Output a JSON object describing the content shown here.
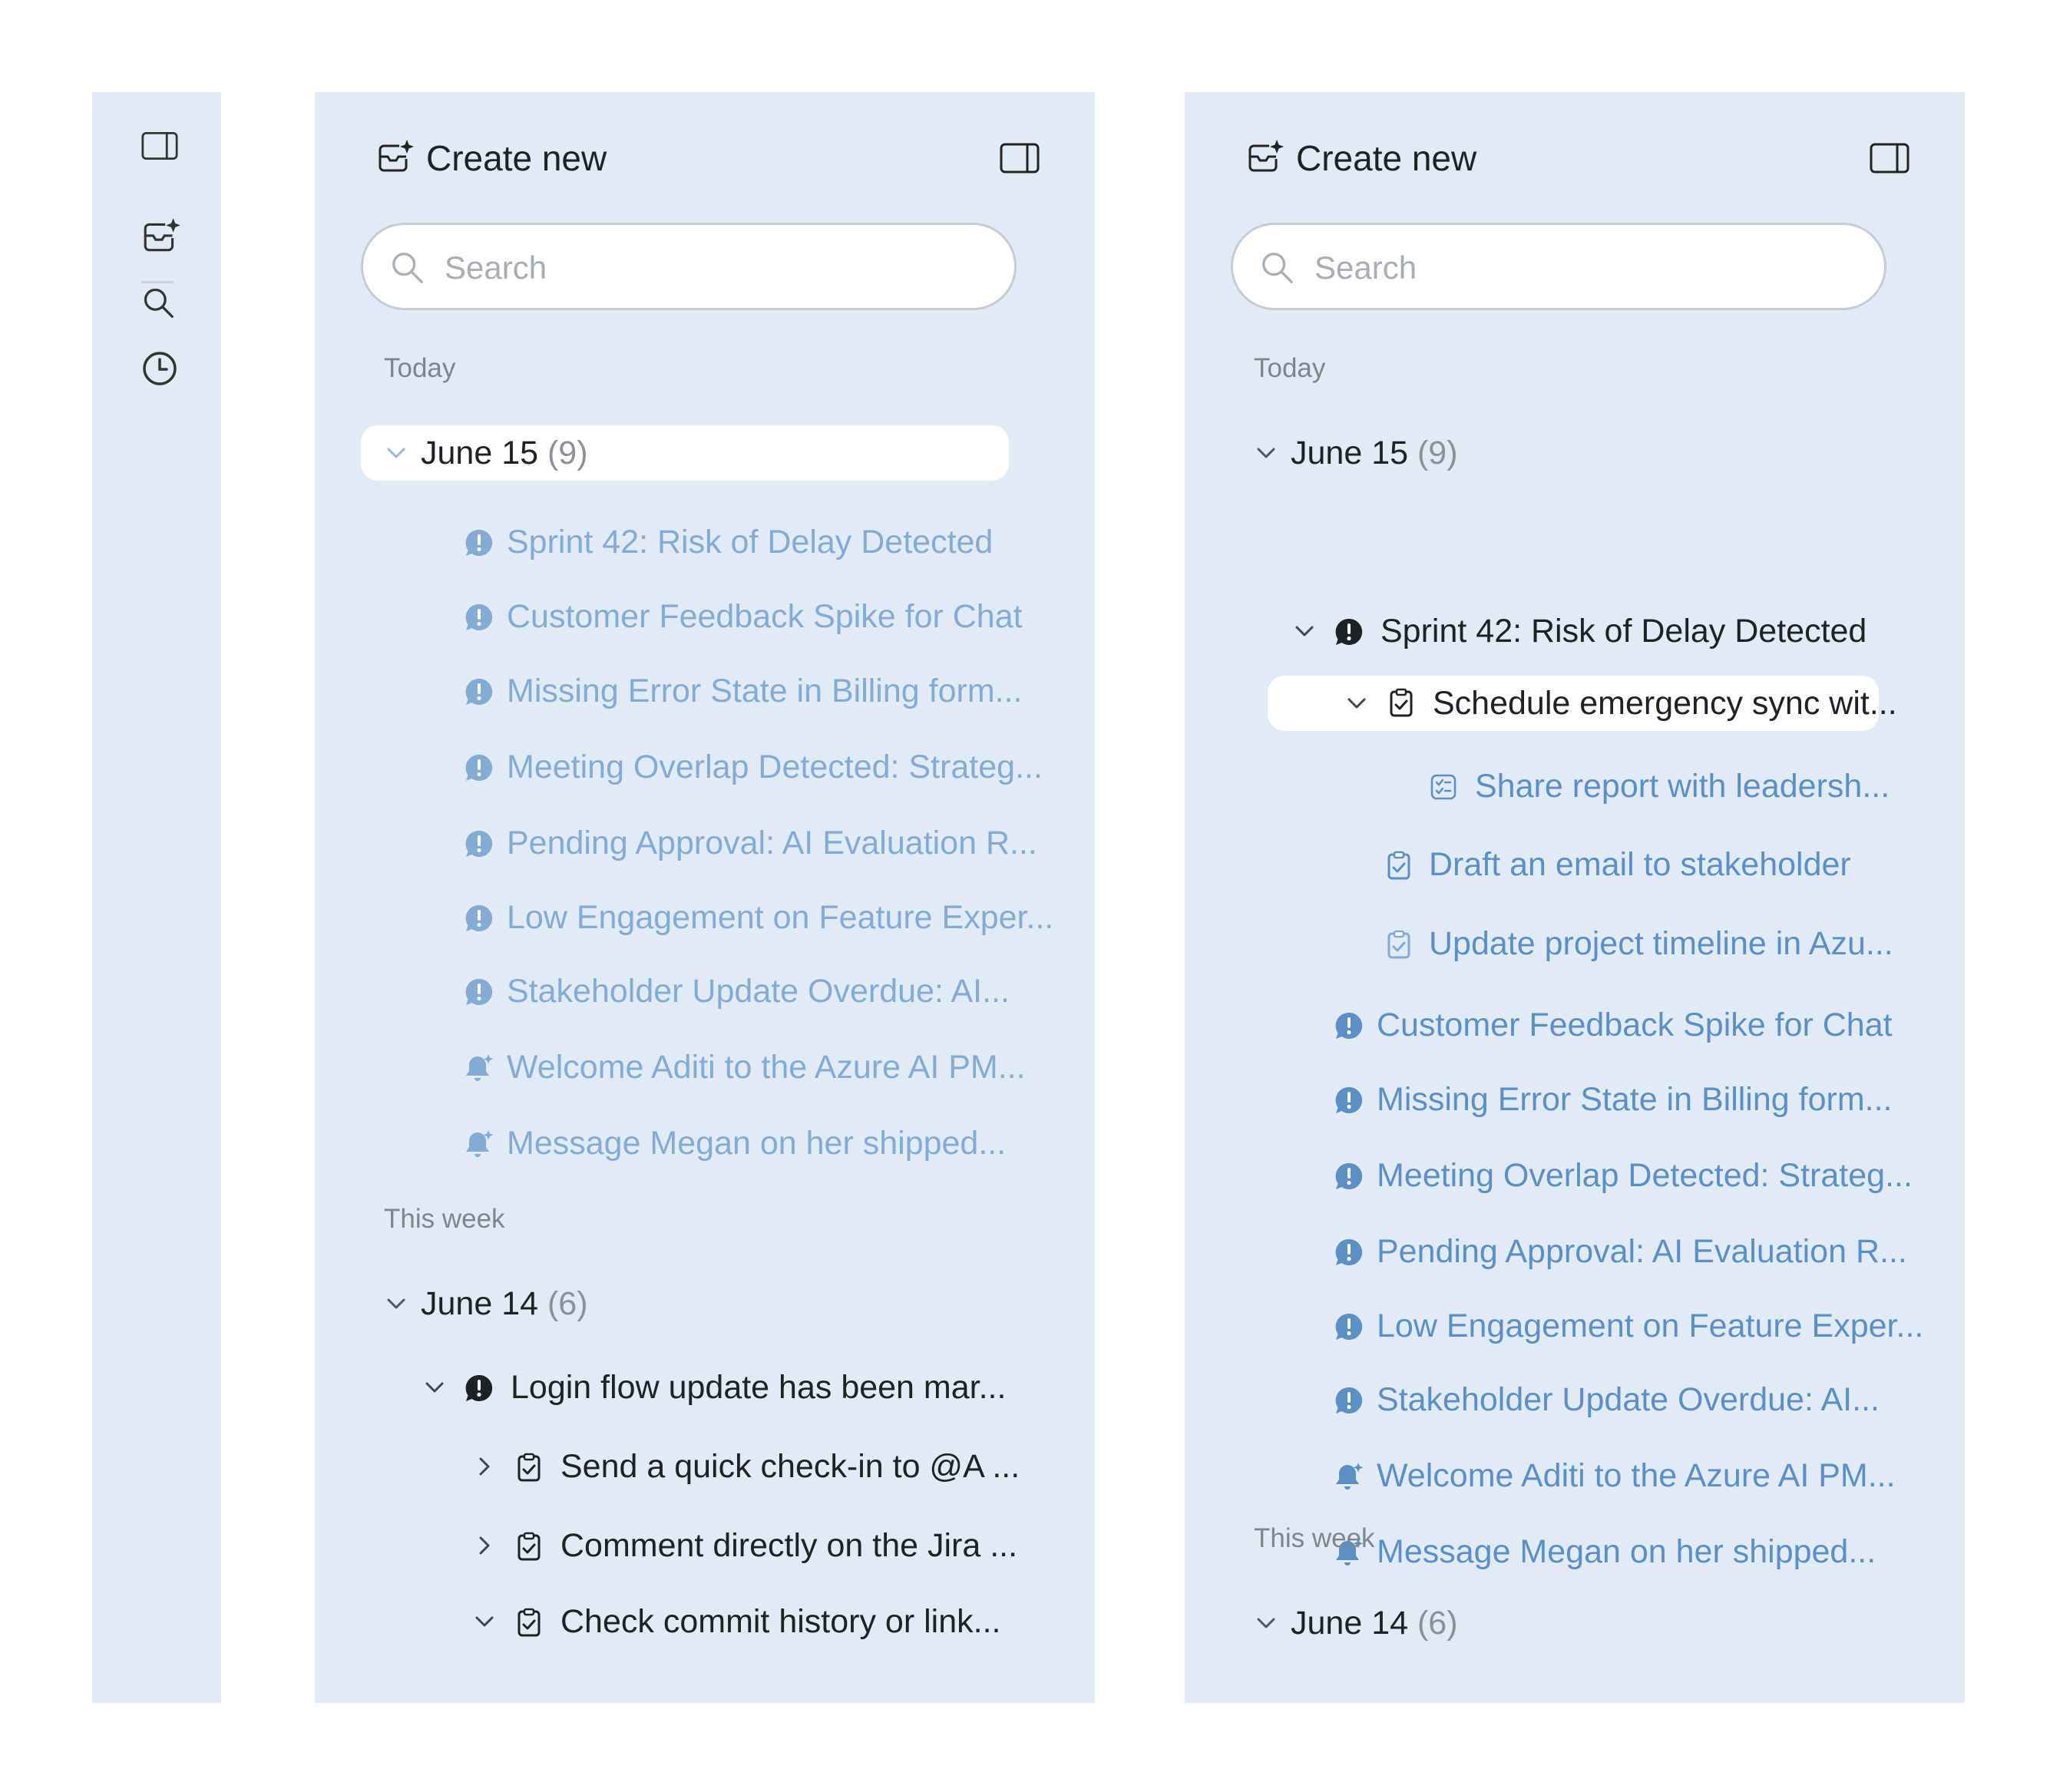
{
  "rail": {
    "icons": [
      "panel-toggle-icon",
      "create-new-icon",
      "search-icon",
      "history-icon"
    ]
  },
  "panels": [
    {
      "header": {
        "title": "Create new"
      },
      "search": {
        "placeholder": "Search"
      },
      "sections": [
        {
          "label": "Today",
          "groups": [
            {
              "label": "June 15",
              "count": "(9)",
              "expanded": true,
              "selected": true,
              "items": [
                {
                  "icon": "alert-icon",
                  "text": "Sprint 42: Risk of Delay Detected"
                },
                {
                  "icon": "alert-icon",
                  "text": "Customer Feedback Spike for Chat"
                },
                {
                  "icon": "alert-icon",
                  "text": "Missing Error State in Billing form..."
                },
                {
                  "icon": "alert-icon",
                  "text": "Meeting Overlap Detected: Strateg..."
                },
                {
                  "icon": "alert-icon",
                  "text": "Pending Approval: AI Evaluation R..."
                },
                {
                  "icon": "alert-icon",
                  "text": "Low Engagement on Feature Exper..."
                },
                {
                  "icon": "alert-icon",
                  "text": "Stakeholder Update Overdue: AI..."
                },
                {
                  "icon": "bell-icon",
                  "text": "Welcome Aditi to the Azure AI PM..."
                },
                {
                  "icon": "bell-icon",
                  "text": "Message Megan on her shipped..."
                }
              ]
            }
          ]
        },
        {
          "label": "This week",
          "groups": [
            {
              "label": "June 14",
              "count": "(6)",
              "expanded": true,
              "items": [
                {
                  "icon": "alert-icon",
                  "text": "Login flow update has been mar...",
                  "expanded": true
                },
                {
                  "icon": "clipboard-icon",
                  "text": "Send a quick check-in to @A ...",
                  "expanded": false
                },
                {
                  "icon": "clipboard-icon",
                  "text": "Comment directly on the Jira ...",
                  "expanded": false
                },
                {
                  "icon": "clipboard-icon",
                  "text": "Check commit history or link...",
                  "expanded": true
                }
              ]
            }
          ]
        }
      ]
    },
    {
      "header": {
        "title": "Create new"
      },
      "search": {
        "placeholder": "Search"
      },
      "sections": [
        {
          "label": "Today",
          "groups": [
            {
              "label": "June 15",
              "count": "(9)",
              "expanded": true,
              "items": [
                {
                  "icon": "alert-icon",
                  "text": "Sprint 42: Risk of Delay Detected",
                  "expanded": true
                },
                {
                  "icon": "clipboard-icon",
                  "text": "Schedule emergency sync wit...",
                  "expanded": true,
                  "selected": true
                },
                {
                  "icon": "checklist-icon",
                  "text": "Share report with leadersh..."
                },
                {
                  "icon": "clipboard-icon",
                  "text": "Draft an email to stakeholder"
                },
                {
                  "icon": "clipboard-icon",
                  "text": "Update project timeline in Azu..."
                },
                {
                  "icon": "alert-icon",
                  "text": "Customer Feedback Spike for Chat"
                },
                {
                  "icon": "alert-icon",
                  "text": "Missing Error State in Billing form..."
                },
                {
                  "icon": "alert-icon",
                  "text": "Meeting Overlap Detected: Strateg..."
                },
                {
                  "icon": "alert-icon",
                  "text": "Pending Approval: AI Evaluation R..."
                },
                {
                  "icon": "alert-icon",
                  "text": "Low Engagement on Feature Exper..."
                },
                {
                  "icon": "alert-icon",
                  "text": "Stakeholder Update Overdue: AI..."
                },
                {
                  "icon": "bell-icon",
                  "text": "Welcome Aditi to the Azure AI PM..."
                },
                {
                  "icon": "bell-icon",
                  "text": "Message Megan on her shipped..."
                }
              ]
            }
          ]
        },
        {
          "label": "This week",
          "groups": [
            {
              "label": "June 14",
              "count": "(6)",
              "expanded": true
            }
          ]
        }
      ]
    }
  ]
}
